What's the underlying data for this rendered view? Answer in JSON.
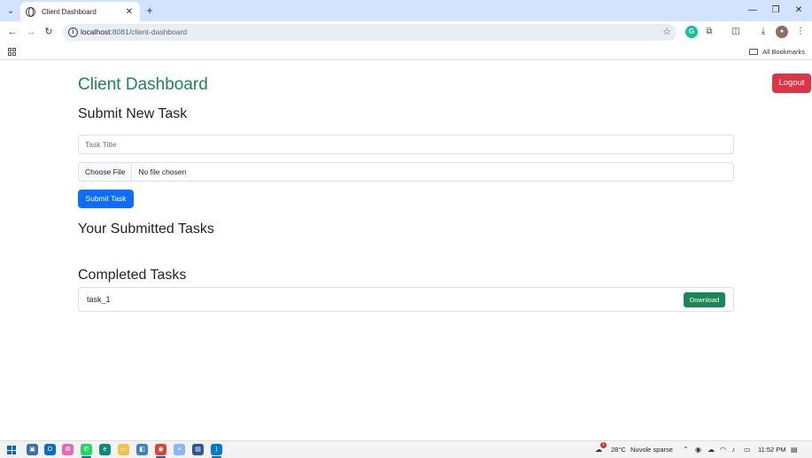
{
  "browser": {
    "tab_title": "Client Dashboard",
    "url_host": "localhost",
    "url_path": ":8081/client-dashboard",
    "bookmarks_label": "All Bookmarks"
  },
  "page": {
    "title": "Client Dashboard",
    "logout_label": "Logout",
    "submit_heading": "Submit New Task",
    "task_title_placeholder": "Task Title",
    "task_title_value": "",
    "choose_file_label": "Choose File",
    "file_status": "No file chosen",
    "submit_label": "Submit Task",
    "submitted_heading": "Your Submitted Tasks",
    "completed_heading": "Completed Tasks",
    "completed_tasks": [
      {
        "name": "task_1",
        "action_label": "Download"
      }
    ]
  },
  "colors": {
    "title_green": "#198754",
    "logout_red": "#dc3545",
    "primary_blue": "#0d6efd",
    "download_green": "#198754"
  },
  "taskbar": {
    "temperature": "28°C",
    "weather": "Nuvole sparse",
    "time": "11:52 PM",
    "weather_badge": "1"
  }
}
